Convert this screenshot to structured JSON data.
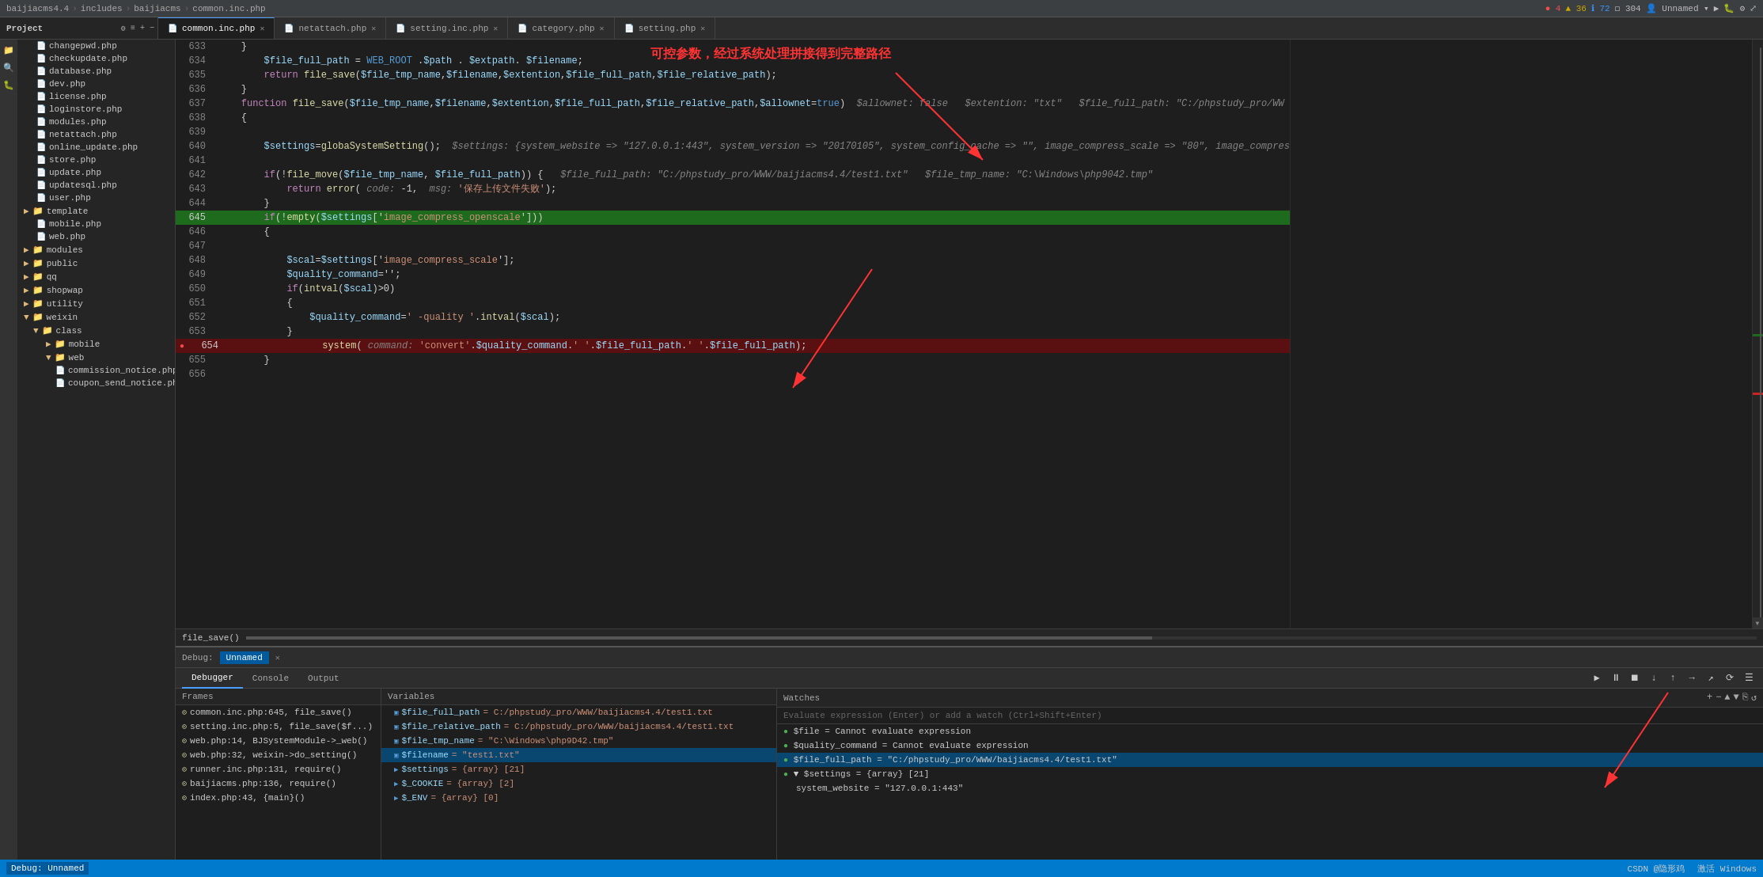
{
  "topbar": {
    "breadcrumb": [
      "baijiacms4.4",
      "includes",
      "baijiacms",
      "common.inc.php"
    ],
    "sep": "›",
    "user": "Unnamed"
  },
  "tabs": [
    {
      "label": "common.inc.php",
      "active": true,
      "modified": false
    },
    {
      "label": "netattach.php",
      "active": false,
      "modified": false
    },
    {
      "label": "setting.inc.php",
      "active": false,
      "modified": false
    },
    {
      "label": "category.php",
      "active": false,
      "modified": false
    },
    {
      "label": "setting.php",
      "active": false,
      "modified": false
    }
  ],
  "sidebar": {
    "project_label": "Project",
    "items": [
      {
        "label": "changepwd.php",
        "level": 2,
        "type": "file"
      },
      {
        "label": "checkupdate.php",
        "level": 2,
        "type": "file"
      },
      {
        "label": "database.php",
        "level": 2,
        "type": "file"
      },
      {
        "label": "dev.php",
        "level": 2,
        "type": "file"
      },
      {
        "label": "license.php",
        "level": 2,
        "type": "file"
      },
      {
        "label": "loginstore.php",
        "level": 2,
        "type": "file"
      },
      {
        "label": "modules.php",
        "level": 2,
        "type": "file"
      },
      {
        "label": "netattach.php",
        "level": 2,
        "type": "file"
      },
      {
        "label": "online_update.php",
        "level": 2,
        "type": "file"
      },
      {
        "label": "store.php",
        "level": 2,
        "type": "file"
      },
      {
        "label": "update.php",
        "level": 2,
        "type": "file"
      },
      {
        "label": "updatesql.php",
        "level": 2,
        "type": "file"
      },
      {
        "label": "user.php",
        "level": 2,
        "type": "file"
      },
      {
        "label": "template",
        "level": 1,
        "type": "folder"
      },
      {
        "label": "mobile.php",
        "level": 2,
        "type": "file"
      },
      {
        "label": "web.php",
        "level": 2,
        "type": "file"
      },
      {
        "label": "modules",
        "level": 1,
        "type": "folder"
      },
      {
        "label": "public",
        "level": 1,
        "type": "folder"
      },
      {
        "label": "qq",
        "level": 1,
        "type": "folder"
      },
      {
        "label": "shopwap",
        "level": 1,
        "type": "folder"
      },
      {
        "label": "utility",
        "level": 1,
        "type": "folder"
      },
      {
        "label": "weixin",
        "level": 1,
        "type": "folder"
      },
      {
        "label": "class",
        "level": 2,
        "type": "folder"
      },
      {
        "label": "mobile",
        "level": 3,
        "type": "folder"
      },
      {
        "label": "web",
        "level": 3,
        "type": "folder"
      },
      {
        "label": "commission_notice.php",
        "level": 4,
        "type": "file"
      },
      {
        "label": "coupon_send_notice.php",
        "level": 4,
        "type": "file"
      }
    ]
  },
  "code": {
    "lines": [
      {
        "num": 633,
        "text": "    }",
        "highlight": false,
        "error": false
      },
      {
        "num": 634,
        "text": "        $file_full_path = WEB_ROOT .$path . $extpath. $filename;",
        "highlight": false,
        "error": false
      },
      {
        "num": 635,
        "text": "        return file_save($file_tmp_name,$filename,$extention,$file_full_path,$file_relative_path);",
        "highlight": false,
        "error": false
      },
      {
        "num": 636,
        "text": "    }",
        "highlight": false,
        "error": false
      },
      {
        "num": 637,
        "text": "    function file_save($file_tmp_name,$filename,$extention,$file_full_path,$file_relative_path,$allownet=true)  $allownet: false   $extention: \"txt\"   $file_full_path: \"C:/phpstudy_pro/WW",
        "highlight": false,
        "error": false,
        "hint": true
      },
      {
        "num": 638,
        "text": "    {",
        "highlight": false,
        "error": false
      },
      {
        "num": 639,
        "text": "",
        "highlight": false,
        "error": false
      },
      {
        "num": 640,
        "text": "        $settings=globaSystemSetting();  $settings: {system_website => \"127.0.0.1:443\", system_version => \"20170105\", system_config_cache => \"\", image_compress_scale => \"80\", image_compres",
        "highlight": false,
        "error": false
      },
      {
        "num": 641,
        "text": "",
        "highlight": false,
        "error": false
      },
      {
        "num": 642,
        "text": "        if(!file_move($file_tmp_name, $file_full_path)) {   $file_full_path: \"C:/phpstudy_pro/WWW/baijiacms4.4/test1.txt\"   $file_tmp_name: \"C:\\Windows\\php9042.tmp\"",
        "highlight": false,
        "error": false
      },
      {
        "num": 643,
        "text": "            return error( code: -1,  msg: '保存上传文件失败');",
        "highlight": false,
        "error": false
      },
      {
        "num": 644,
        "text": "        }",
        "highlight": false,
        "error": false
      },
      {
        "num": 645,
        "text": "        if(!empty($settings['image_compress_openscale']))",
        "highlight": true,
        "error": false,
        "breakpoint": true
      },
      {
        "num": 646,
        "text": "        {",
        "highlight": false,
        "error": false
      },
      {
        "num": 647,
        "text": "",
        "highlight": false,
        "error": false
      },
      {
        "num": 648,
        "text": "            $scal=$settings['image_compress_scale'];",
        "highlight": false,
        "error": false
      },
      {
        "num": 649,
        "text": "            $quality_command='';",
        "highlight": false,
        "error": false
      },
      {
        "num": 650,
        "text": "            if(intval($scal)>0)",
        "highlight": false,
        "error": false
      },
      {
        "num": 651,
        "text": "            {",
        "highlight": false,
        "error": false
      },
      {
        "num": 652,
        "text": "                $quality_command=' -quality '.intval($scal);",
        "highlight": false,
        "error": false
      },
      {
        "num": 653,
        "text": "            }",
        "highlight": false,
        "error": false
      },
      {
        "num": 654,
        "text": "                system( command: 'convert'.$quality_command.' '.$file_full_path.' '.$file_full_path);",
        "highlight": false,
        "error": true,
        "breakpoint": true
      },
      {
        "num": 655,
        "text": "        }",
        "highlight": false,
        "error": false
      },
      {
        "num": 656,
        "text": "",
        "highlight": false,
        "error": false
      }
    ]
  },
  "annotation1": {
    "text": "可控参数，经过系统处理拼接得到完整路径"
  },
  "statusbar": {
    "function_name": "file_save()"
  },
  "debug": {
    "label": "Debug:",
    "session": "Unnamed",
    "tabs": [
      "Debugger",
      "Console",
      "Output"
    ],
    "active_tab": "Debugger",
    "toolbar_buttons": [
      "▶",
      "⏸",
      "⏹",
      "↓",
      "↑",
      "→",
      "↗",
      "⟳"
    ],
    "frames_header": "Frames",
    "frames": [
      {
        "icon": "⊙",
        "text": "common.inc.php:645, file_save()"
      },
      {
        "icon": "⊙",
        "text": "setting.inc.php:5, file_save($f...)"
      },
      {
        "icon": "⊙",
        "text": "web.php:14, BJSystemModule->_web()"
      },
      {
        "icon": "⊙",
        "text": "web.php:32, weixin->do_setting()"
      },
      {
        "icon": "⊙",
        "text": "runner.inc.php:131, require()"
      },
      {
        "icon": "⊙",
        "text": "baijiacms.php:136, require()"
      },
      {
        "icon": "⊙",
        "text": "index.php:43, {main}()"
      }
    ],
    "variables_header": "Variables",
    "variables": [
      {
        "name": "$file_full_path",
        "value": "= C:/phpstudy_pro/WWW/baijiacms4.4/test1.txt",
        "selected": false
      },
      {
        "name": "$file_relative_path",
        "value": "= C:/phpstudy_pro/WWW/baijiacms4.4/test1.txt",
        "selected": false
      },
      {
        "name": "$file_tmp_name",
        "value": "= \"C:\\Windows\\php9D42.tmp\"",
        "selected": false
      },
      {
        "name": "$filename",
        "value": "= \"test1.txt\"",
        "selected": true
      },
      {
        "name": "$settings",
        "value": "= {array} [21]",
        "selected": false,
        "expandable": true
      },
      {
        "name": "$_COOKIE",
        "value": "= {array} [2]",
        "selected": false,
        "expandable": true
      },
      {
        "name": "$_ENV",
        "value": "= {array} [0]",
        "selected": false,
        "expandable": true
      }
    ],
    "watches_header": "Watches",
    "evaluate_placeholder": "Evaluate expression (Enter) or add a watch (Ctrl+Shift+Enter)",
    "watches": [
      {
        "text": "$file = Cannot evaluate expression",
        "icon": "●",
        "icon_color": "#4caf50"
      },
      {
        "text": "$quality_command = Cannot evaluate expression",
        "icon": "●",
        "icon_color": "#4caf50"
      },
      {
        "text": "$file_full_path = \"C:/phpstudy_pro/WWW/baijiacms4.4/test1.txt\"",
        "icon": "●",
        "icon_color": "#4caf50",
        "selected": true
      },
      {
        "text": "▼ $settings = {array} [21]",
        "icon": "●",
        "icon_color": "#4caf50"
      },
      {
        "text": "  system_website = \"127.0.0.1:443\"",
        "icon": "",
        "icon_color": ""
      }
    ]
  },
  "errors": {
    "error_count": 4,
    "warning_count": 36,
    "info_count": 72,
    "other_count": 304
  },
  "bottom_bar": {
    "csdn_label": "CSDN @隐形鸡",
    "windows_label": "激活 Windows"
  }
}
